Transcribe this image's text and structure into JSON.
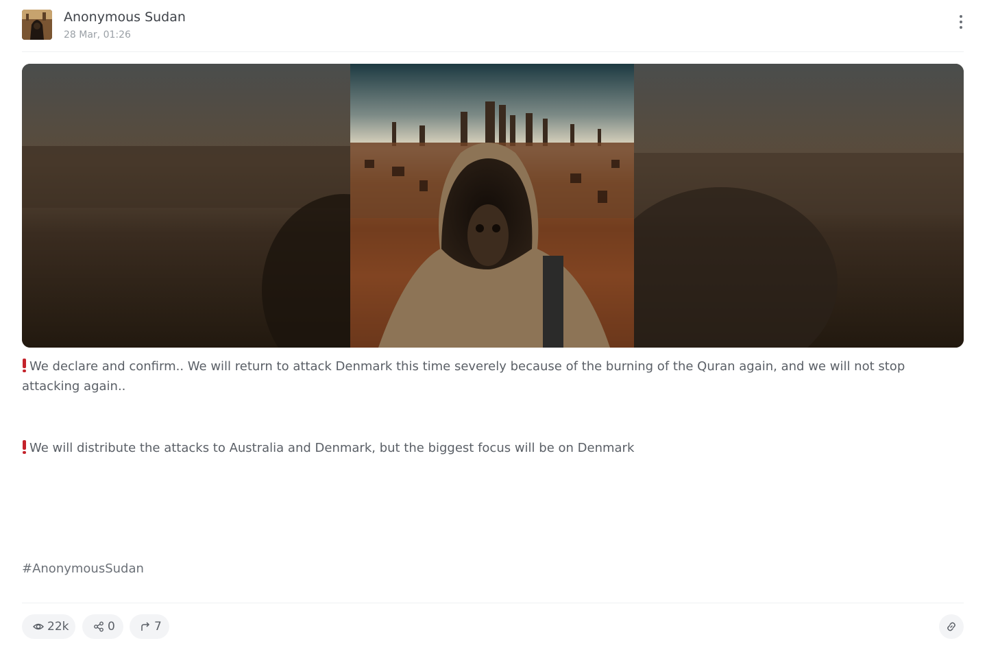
{
  "post": {
    "author": "Anonymous Sudan",
    "timestamp": "28 Mar, 01:26",
    "paragraphs": [
      "We declare and confirm.. We will return to attack Denmark this time severely because of the burning of the Quran again, and we will not stop attacking again..",
      "We will distribute the attacks to Australia and Denmark, but the biggest focus will be on Denmark"
    ],
    "hashtag": "#AnonymousSudan"
  },
  "stats": {
    "views": "22k",
    "shares": "0",
    "forwards": "7"
  },
  "icons": {
    "menu": "more-vertical-icon",
    "views": "eye-icon",
    "shares": "share-icon",
    "forwards": "forward-arrow-icon",
    "link": "link-icon",
    "paragraph_marker": "red-exclamation-icon"
  },
  "colors": {
    "accent_red": "#c4232b",
    "pill_background": "#f3f4f6",
    "muted_text": "#9aa0a6"
  }
}
